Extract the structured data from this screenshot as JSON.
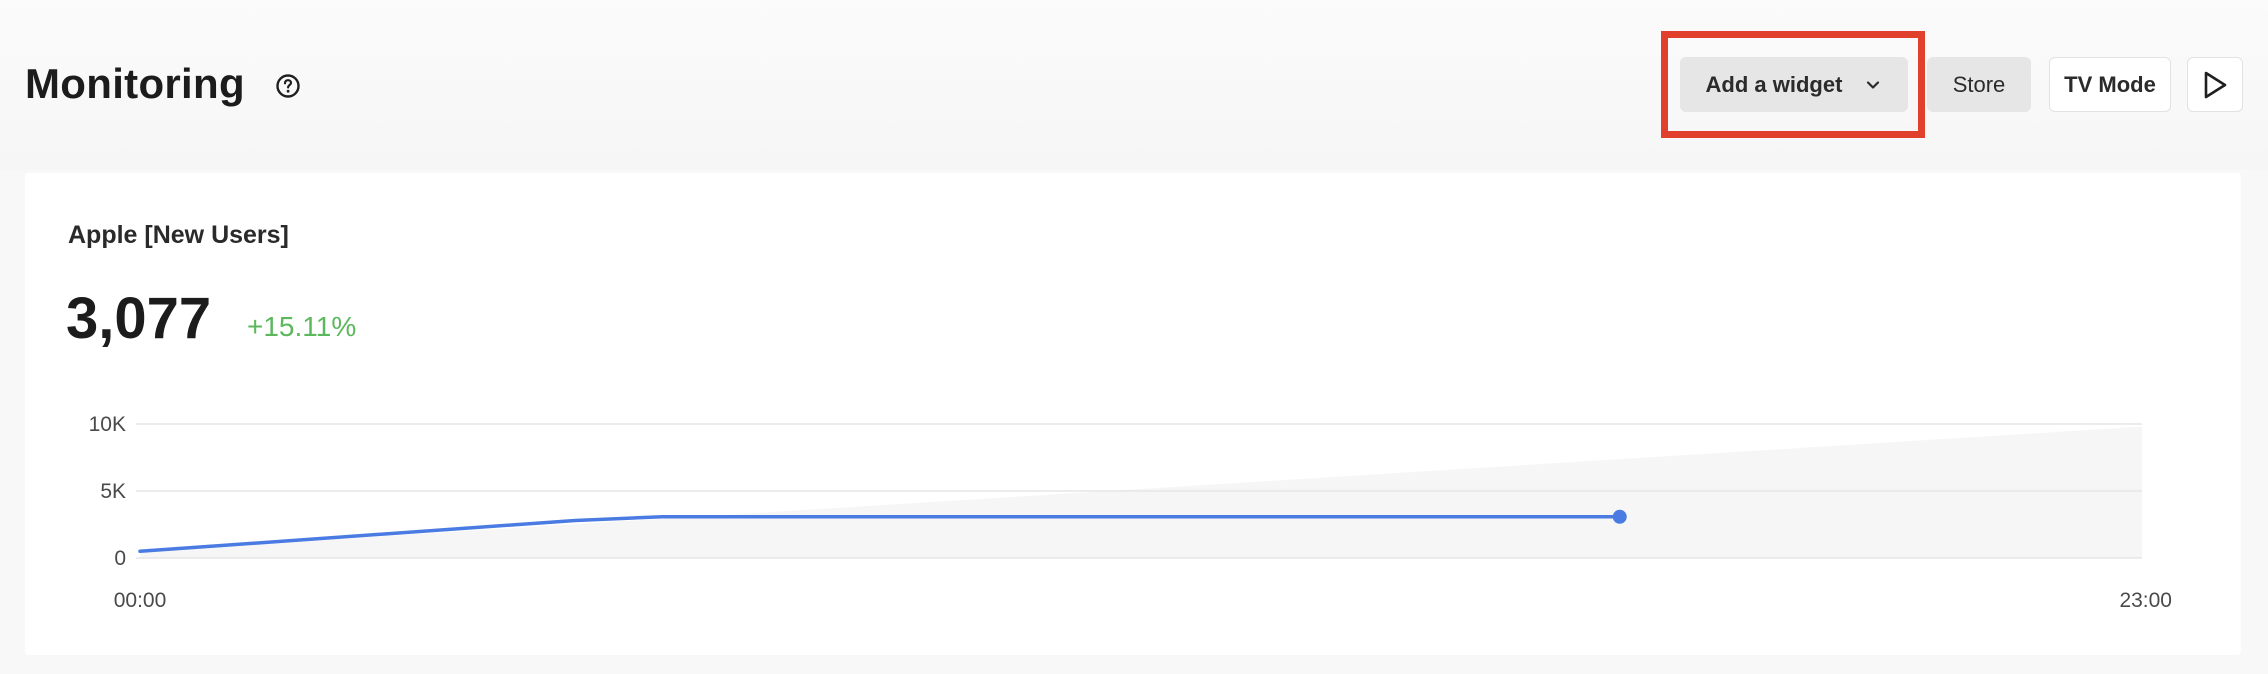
{
  "header": {
    "title": "Monitoring",
    "help_icon": "help-circle-icon",
    "add_widget_label": "Add a widget",
    "store_label": "Store",
    "tv_mode_label": "TV Mode",
    "play_icon": "play-icon"
  },
  "widget": {
    "title": "Apple [New Users]",
    "value": "3,077",
    "change": "+15.11%"
  },
  "colors": {
    "accent": "#4a7be3",
    "positive": "#5cb85c",
    "highlight": "#e0402c"
  },
  "chart_data": {
    "type": "line",
    "title": "",
    "x_ticks": [
      "00:00",
      "23:00"
    ],
    "y_ticks": [
      {
        "label": "10K",
        "value": 10000
      },
      {
        "label": "5K",
        "value": 5000
      },
      {
        "label": "0",
        "value": 0
      }
    ],
    "xlim": [
      0,
      23
    ],
    "ylim": [
      0,
      10000
    ],
    "grid": true,
    "series": [
      {
        "x": [
          0,
          5,
          6,
          17
        ],
        "values": [
          500,
          2800,
          3077,
          3077
        ]
      }
    ],
    "forecast_band_end": 9800
  }
}
